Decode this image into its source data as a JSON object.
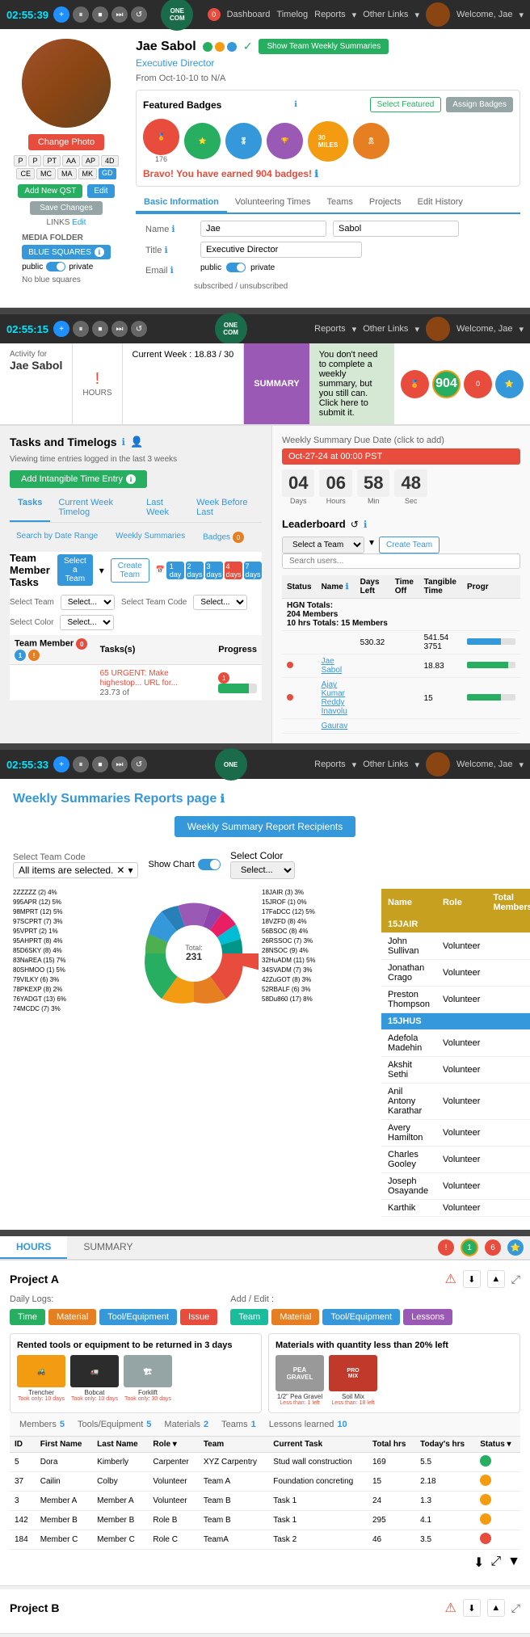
{
  "nav": {
    "timer": "02:55:39",
    "timer2": "02:55:15",
    "dashboard": "Dashboard",
    "timelog": "Timelog",
    "reports": "Reports",
    "other_links": "Other Links",
    "welcome": "Welcome, Jae"
  },
  "profile": {
    "name": "Jae Sabol",
    "title": "Executive Director",
    "from": "Oct-10-10",
    "to": "N/A",
    "show_team_btn": "Show Team Weekly Summaries",
    "change_photo": "Change Photo",
    "tags": [
      "P",
      "P",
      "PT",
      "AA",
      "AP",
      "4D",
      "CE",
      "MC",
      "MA",
      "MK",
      "GD"
    ],
    "add_qst": "Add New QST",
    "edit": "Edit",
    "save_changes": "Save Changes",
    "links_edit": "LINKS Edit",
    "media_folder": "MEDIA FOLDER",
    "blue_squares": "BLUE SQUARES",
    "private": "private",
    "no_blue": "No blue squares",
    "badge_count": "904",
    "bravo_text": "Bravo! You have earned",
    "bravo_count": "904",
    "bravo_end": "badges!",
    "featured_badges": "Featured Badges",
    "select_featured": "Select Featured",
    "assign_badges": "Assign Badges",
    "tabs": [
      "Basic Information",
      "Volunteering Times",
      "Teams",
      "Projects",
      "Edit History"
    ],
    "active_tab": "Basic Information",
    "form": {
      "name_label": "Name",
      "first_name": "Jae",
      "last_name": "Sabol",
      "title_label": "Title",
      "title_val": "Executive Director",
      "email_label": "Email",
      "email_public": "public",
      "email_private": "private",
      "email_subscribed": "subscribed",
      "email_unsubscribed": "unsubscribed"
    }
  },
  "activity": {
    "for_label": "Activity for",
    "for_name": "Jae Sabol",
    "hours_label": "HOURS",
    "current_week": "Current Week : 18.83 / 30",
    "summary": "SUMMARY",
    "notice": "You don't need to complete a weekly summary, but you still can. Click here to submit it."
  },
  "tasks": {
    "title": "Tasks and Timelogs",
    "sub_title": "Viewing time entries logged in the last 3 weeks",
    "add_btn": "Add Intangible Time Entry",
    "tabs": [
      "Tasks",
      "Current Week Timelog",
      "Last Week",
      "Week Before Last"
    ],
    "sub_tabs": [
      "Search by Date Range",
      "Weekly Summaries",
      "Badges"
    ],
    "active_tab": "Tasks",
    "team_member_tasks": "Team Member Tasks",
    "select_team": "Select a Team",
    "create_team": "Create Team",
    "day_filters": [
      "1 day",
      "2 days",
      "3 days",
      "4 days",
      "7 days"
    ],
    "filter_labels": {
      "select_team": "Select Team",
      "select_code": "Select Team Code",
      "select_color": "Select Color"
    },
    "table": {
      "headers": [
        "Team Member",
        "Tasks(s)",
        "Progress"
      ],
      "rows": [
        {
          "member": "",
          "tasks": "65 URGENT: Make highestop... URL for...",
          "progress": "23.73 of",
          "urgent": true
        }
      ]
    }
  },
  "weekly_due": {
    "title": "Weekly Summary Due Date (click to add)",
    "date": "Oct-27-24 at 00:00 PST",
    "countdown": {
      "days": "04",
      "hours": "06",
      "min": "58",
      "sec": "48"
    },
    "labels": [
      "Days",
      "Hours",
      "Min",
      "Sec"
    ]
  },
  "leaderboard": {
    "title": "Leaderboard",
    "select_team": "Select a Team",
    "create_team": "Create Team",
    "search_placeholder": "Search users...",
    "table": {
      "headers": [
        "Status",
        "Name",
        "Days Left",
        "Time Off",
        "Tangible Time",
        "Progr"
      ],
      "hgn": {
        "label": "HGN Totals:",
        "members": "204 Members",
        "sub_members": "10 hrs Totals: 15 Members",
        "days_left": "530.32",
        "tangible": "541.54 3751"
      },
      "rows": [
        {
          "status": "red",
          "name": "Jae Sabol",
          "tangible": "18.83",
          "progress_pct": 85
        },
        {
          "status": "red",
          "name": "Ajay Kumar Reddy Inavolu",
          "tangible": "15",
          "progress_pct": 70
        },
        {
          "status": "gray",
          "name": "Gaurav",
          "tangible": "",
          "progress_pct": 0
        }
      ]
    }
  },
  "weekly_summaries": {
    "title": "Weekly Summaries Reports page",
    "info_icon": "ℹ",
    "recipients_btn": "Weekly Summary Report Recipients",
    "filters": {
      "team_code_label": "Select Team Code",
      "show_chart_label": "Show Chart",
      "color_label": "Select Color",
      "all_selected": "All items are selected.",
      "select_placeholder": "Select..."
    },
    "chart": {
      "total": "231",
      "segments": [
        {
          "label": "2ZZZZZ (2) 4%",
          "color": "#e74c3c"
        },
        {
          "label": "995APR (12) 5%",
          "color": "#e67e22"
        },
        {
          "label": "98MPRT (12) 5%",
          "color": "#f39c12"
        },
        {
          "label": "97SCPRT (7) 3%",
          "color": "#27ae60"
        },
        {
          "label": "95VPRT (2) 1%",
          "color": "#1abc9c"
        },
        {
          "label": "95AHPRT (8) 4%",
          "color": "#3498db"
        },
        {
          "label": "85D6SKY (8) 4%",
          "color": "#2980b9"
        },
        {
          "label": "83NaREA (15) 7%",
          "color": "#9b59b6"
        },
        {
          "label": "80SHMOO (1) 5%",
          "color": "#8e44ad"
        },
        {
          "label": "79VILKY (6) 3%",
          "color": "#e91e63"
        },
        {
          "label": "78PKEXP (8) 2%",
          "color": "#00bcd4"
        },
        {
          "label": "76YADGT (13) 6%",
          "color": "#009688"
        },
        {
          "label": "74MCDC (7) 3%",
          "color": "#4caf50"
        }
      ]
    },
    "members_table": {
      "headers": [
        "Name",
        "Role",
        "Total Members"
      ],
      "teams": [
        {
          "team_id": "15JAIR",
          "members": [
            {
              "name": "John Sullivan",
              "role": "Volunteer"
            },
            {
              "name": "Jonathan Crago",
              "role": "Volunteer"
            },
            {
              "name": "Preston Thompson",
              "role": "Volunteer"
            }
          ]
        },
        {
          "team_id": "15JHUS",
          "members": [
            {
              "name": "Adefola Madehin",
              "role": "Volunteer"
            },
            {
              "name": "Akshit Sethi",
              "role": "Volunteer"
            },
            {
              "name": "Anil Antony Karathar",
              "role": "Volunteer"
            },
            {
              "name": "Avery Hamilton",
              "role": "Volunteer"
            },
            {
              "name": "Charles Gooley",
              "role": "Volunteer"
            },
            {
              "name": "Joseph Osayande",
              "role": "Volunteer"
            },
            {
              "name": "Karthik",
              "role": "Volunteer"
            }
          ]
        }
      ]
    }
  },
  "hs_tabs": {
    "hours": "HOURS",
    "summary": "SUMMARY"
  },
  "project_a": {
    "title": "Project A",
    "daily_logs": "Daily Logs:",
    "add_edit": "Add / Edit :",
    "log_btns": [
      "Time",
      "Material",
      "Tool/Equipment",
      "Issue"
    ],
    "edit_btns": [
      "Team",
      "Material",
      "Tool/Equipment",
      "Lessons"
    ],
    "tools_title": "Rented tools or equipment to be returned in 3 days",
    "tools": [
      {
        "name": "Trencher",
        "sub": "Took only: 10 days"
      },
      {
        "name": "Bobcat",
        "sub": "Took only: 10 days"
      },
      {
        "name": "Forklift",
        "sub": "Took only: 30 days"
      }
    ],
    "materials_title": "Materials with quantity less than 20% left",
    "materials": [
      {
        "name": "1/2\" Pea Gravel",
        "sub": "Less than: 1 left"
      },
      {
        "name": "Soil Mix",
        "sub": "Less than: 18 left"
      }
    ],
    "stats": {
      "members": "5",
      "tools": "5",
      "materials": "2",
      "teams": "1",
      "lessons": "10"
    },
    "table": {
      "headers": [
        "ID",
        "First Name",
        "Last Name",
        "Role",
        "Team",
        "Current Task",
        "Total hrs",
        "Today's hrs",
        "Status"
      ],
      "rows": [
        {
          "id": "5",
          "first": "Dora",
          "last": "Kimberly",
          "role": "Carpenter",
          "team": "XYZ Carpentry",
          "task": "Stud wall construction",
          "total": "169",
          "today": "5.5",
          "status": "green"
        },
        {
          "id": "37",
          "first": "Cailin",
          "last": "Colby",
          "role": "Volunteer",
          "team": "Team A",
          "task": "Foundation concreting",
          "total": "15",
          "today": "2.18",
          "status": "yellow"
        },
        {
          "id": "3",
          "first": "Member A",
          "last": "Member A",
          "role": "Volunteer",
          "team": "Team B",
          "task": "Task 1",
          "total": "24",
          "today": "1.3",
          "status": "yellow"
        },
        {
          "id": "142",
          "first": "Member B",
          "last": "Member B",
          "role": "Role B",
          "team": "Team B",
          "task": "Task 1",
          "total": "295",
          "today": "4.1",
          "status": "yellow"
        },
        {
          "id": "184",
          "first": "Member C",
          "last": "Member C",
          "role": "Role C",
          "team": "TeamA",
          "task": "Task 2",
          "total": "46",
          "today": "3.5",
          "status": "red"
        }
      ]
    }
  },
  "project_b": {
    "title": "Project B"
  },
  "badges": {
    "items": [
      {
        "color": "#e74c3c",
        "num": "176"
      },
      {
        "color": "#27ae60",
        "num": ""
      },
      {
        "color": "#3498db",
        "num": ""
      },
      {
        "color": "#9b59b6",
        "num": ""
      },
      {
        "color": "#f39c12",
        "num": "30"
      },
      {
        "color": "#e67e22",
        "num": ""
      }
    ]
  }
}
